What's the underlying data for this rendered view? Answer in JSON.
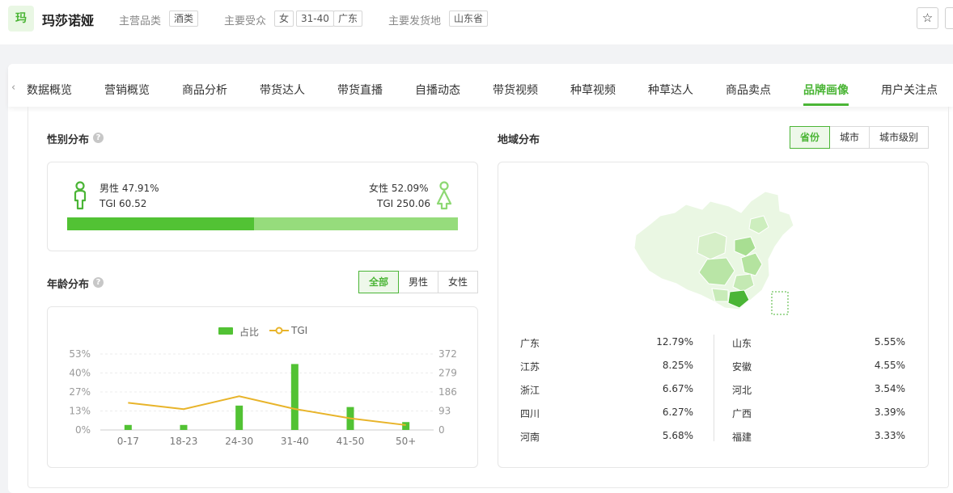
{
  "header": {
    "logo_char": "玛",
    "brand": "玛莎诺娅",
    "category_label": "主营品类",
    "category": "酒类",
    "audience_label": "主要受众",
    "audience_tags": [
      "女",
      "31-40",
      "广东"
    ],
    "ship_label": "主要发货地",
    "ship_from": "山东省",
    "star_icon": "star-icon"
  },
  "tabs": {
    "prev_icon": "chevron-left-icon",
    "items": [
      "数据概览",
      "营销概览",
      "商品分析",
      "带货达人",
      "带货直播",
      "自播动态",
      "带货视频",
      "种草视频",
      "种草达人",
      "商品卖点",
      "品牌画像",
      "用户关注点"
    ],
    "active": "品牌画像"
  },
  "gender": {
    "title": "性别分布",
    "help": "?",
    "male_label": "男性 47.91%",
    "male_tgi": "TGI 60.52",
    "female_label": "女性 52.09%",
    "female_tgi": "TGI 250.06",
    "male_share": 47.91,
    "female_share": 52.09,
    "colors": {
      "male": "#52c234",
      "female": "#96dc7c"
    }
  },
  "age": {
    "title": "年龄分布",
    "help": "?",
    "filters": [
      "全部",
      "男性",
      "女性"
    ],
    "active_filter": "全部"
  },
  "region": {
    "title": "地域分布",
    "filters": [
      "省份",
      "城市",
      "城市级别"
    ],
    "active_filter": "省份",
    "left": [
      {
        "name": "广东",
        "value": "12.79%"
      },
      {
        "name": "江苏",
        "value": "8.25%"
      },
      {
        "name": "浙江",
        "value": "6.67%"
      },
      {
        "name": "四川",
        "value": "6.27%"
      },
      {
        "name": "河南",
        "value": "5.68%"
      }
    ],
    "right": [
      {
        "name": "山东",
        "value": "5.55%"
      },
      {
        "name": "安徽",
        "value": "4.55%"
      },
      {
        "name": "河北",
        "value": "3.54%"
      },
      {
        "name": "广西",
        "value": "3.39%"
      },
      {
        "name": "福建",
        "value": "3.33%"
      }
    ]
  },
  "chart_data": {
    "type": "bar",
    "categories": [
      "0-17",
      "18-23",
      "24-30",
      "31-40",
      "41-50",
      "50+"
    ],
    "series": [
      {
        "name": "占比",
        "axis": "left",
        "type": "bar",
        "values": [
          3.5,
          3.5,
          17,
          46,
          16,
          5.5
        ],
        "color": "#52c234"
      },
      {
        "name": "TGI",
        "axis": "right",
        "type": "line",
        "values": [
          133,
          102,
          165,
          103,
          57,
          24
        ],
        "color": "#e8b42a"
      }
    ],
    "y_left_ticks": [
      "53%",
      "40%",
      "27%",
      "13%",
      "0%"
    ],
    "y_right_ticks": [
      "372",
      "279",
      "186",
      "93",
      "0"
    ],
    "ylim_left": [
      0,
      53
    ],
    "ylim_right": [
      0,
      372
    ],
    "legend_placement": "top-center",
    "grid": true
  }
}
